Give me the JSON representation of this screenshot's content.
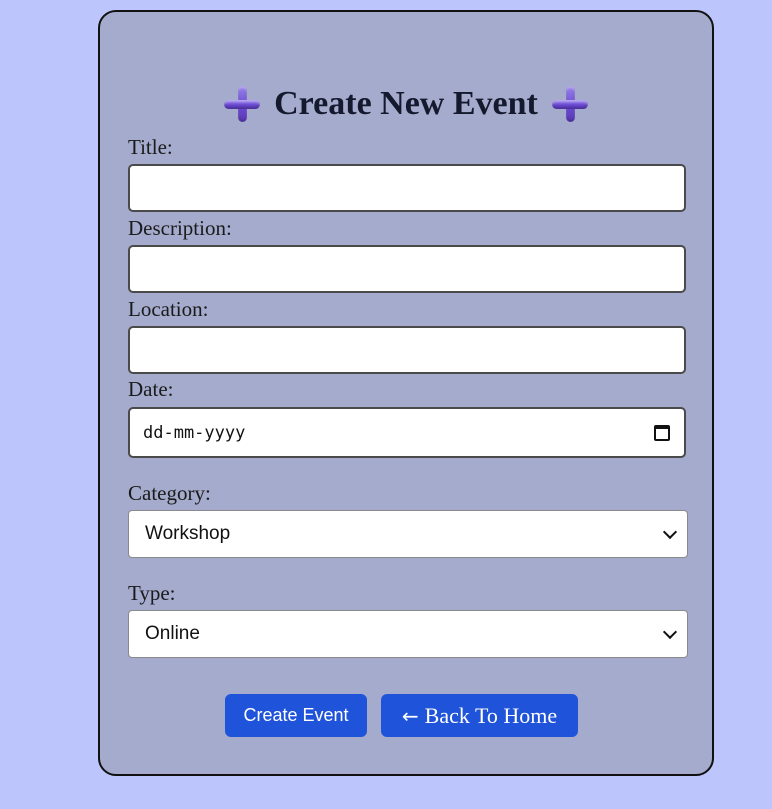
{
  "form": {
    "title": "Create New Event",
    "icons": [
      "plus-icon",
      "plus-icon"
    ],
    "fields": {
      "title": {
        "label": "Title:",
        "value": "",
        "placeholder": ""
      },
      "description": {
        "label": "Description:",
        "value": "",
        "placeholder": ""
      },
      "location": {
        "label": "Location:",
        "value": "",
        "placeholder": ""
      },
      "date": {
        "label": "Date:",
        "placeholder": "dd-mm-yyyy",
        "icon": "calendar-icon"
      },
      "category": {
        "label": "Category:",
        "selected": "Workshop"
      },
      "type": {
        "label": "Type:",
        "selected": "Online"
      }
    },
    "buttons": {
      "create": "Create Event",
      "back_arrow": "←",
      "back": "Back To Home"
    }
  },
  "colors": {
    "page_background": "#bcc6fd",
    "card_background": "#a4abcc",
    "button_primary": "#1f53d9",
    "icon_accent": "#6b4ad3"
  }
}
